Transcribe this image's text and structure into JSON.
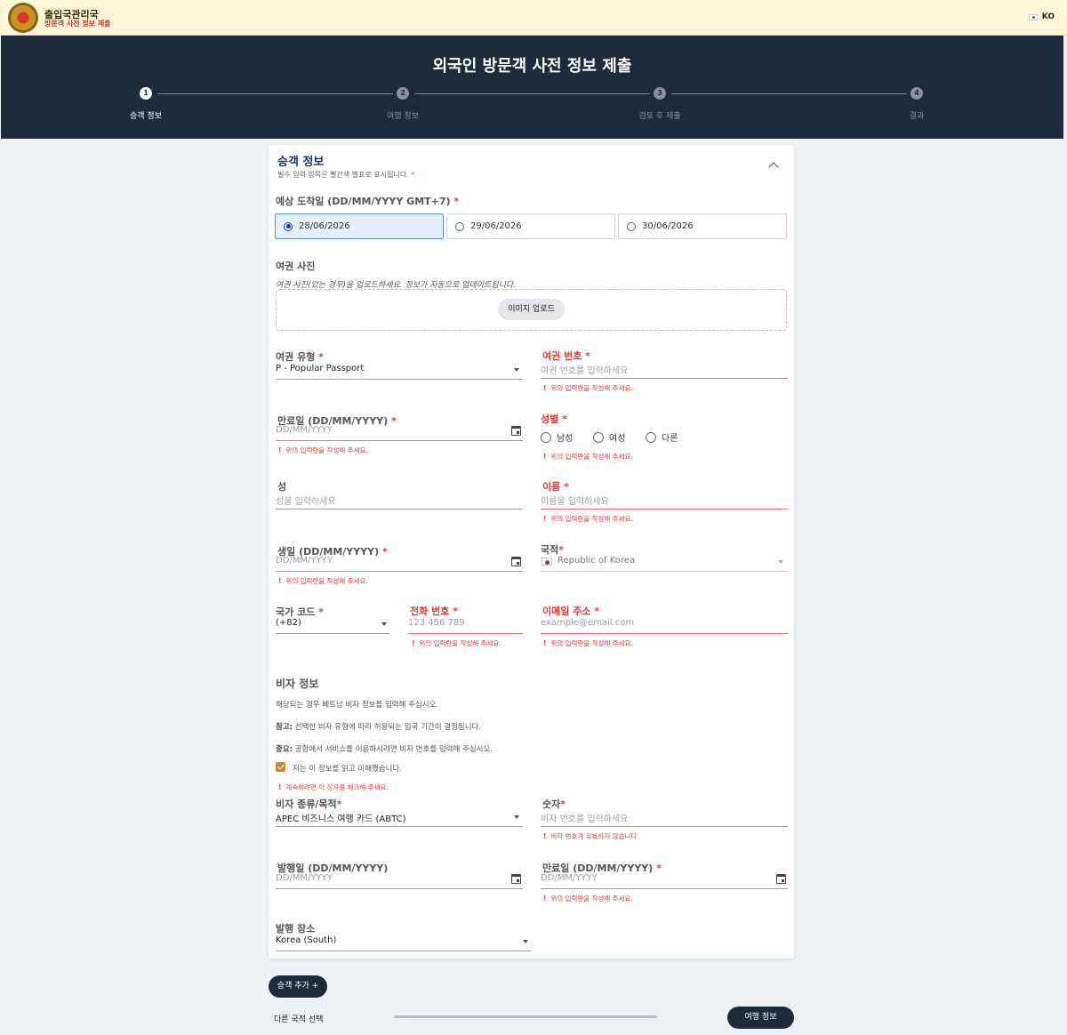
{
  "topbar": {
    "org_name": "출입국관리국",
    "org_sub": "방문객 사전 정보 제출",
    "lang": "KO"
  },
  "header": {
    "title": "외국인 방문객 사전 정보 제출",
    "steps": [
      {
        "num": "1",
        "label": "승객 정보"
      },
      {
        "num": "2",
        "label": "여행 정보"
      },
      {
        "num": "3",
        "label": "검토 후 제출"
      },
      {
        "num": "4",
        "label": "결과"
      }
    ]
  },
  "passenger": {
    "title": "승객 정보",
    "note": "필수 입력 항목은 빨간색 별표로 표시됩니다.",
    "req_mark": "*",
    "arrival_label": "예상 도착일 (DD/MM/YYYY GMT+7)",
    "arrival_options": [
      "28/06/2026",
      "29/06/2026",
      "30/06/2026"
    ],
    "passport_photo_label": "여권 사진",
    "passport_photo_hint": "여권 사진(있는 경우)을 업로드하세요. 정보가 자동으로 업데이트됩니다.",
    "upload_button": "이미지 업로드",
    "passport_type_label": "여권 유형",
    "passport_type_value": "P - Popular Passport",
    "passport_no_label": "여권 번호",
    "passport_no_placeholder": "여권 번호를 입력하세요",
    "error_required": "위의 입력란을 작성해 주세요.",
    "error_icon": "!",
    "expiry_label": "만료일 (DD/MM/YYYY)",
    "date_placeholder": "DD/MM/YYYY",
    "gender_label": "성별",
    "gender_options": [
      "남성",
      "여성",
      "다른"
    ],
    "surname_label": "성",
    "surname_placeholder": "성을 입력하세요",
    "given_label": "이름",
    "given_placeholder": "이름을 입력하세요",
    "dob_label": "생일 (DD/MM/YYYY)",
    "nationality_label": "국적",
    "nationality_value": "Republic of Korea",
    "country_code_label": "국가 코드",
    "country_code_value": "(+82)",
    "phone_label": "전화 번호",
    "phone_placeholder": "123 456 789",
    "email_label": "이메일 주소",
    "email_placeholder": "example@email.com"
  },
  "visa": {
    "title": "비자 정보",
    "text1": "해당되는 경우 베트남 비자 정보를 입력해 주십시오.",
    "text2_bold": "참고:",
    "text2": " 선택한 비자 유형에 따라 허용되는 입국 기간이 결정됩니다.",
    "text3_bold": "중요:",
    "text3": " 공항에서 서비스를 이용하시려면 비자 번호를 입력해 주십시오.",
    "checkbox_label": "저는 이 정보를 읽고 이해했습니다.",
    "checkbox_error": "계속하려면 이 상자를 체크해 주세요.",
    "type_label": "비자 종류/목적",
    "type_value": "APEC 비즈니스 여행 카드 (ABTC)",
    "number_label": "숫자",
    "number_placeholder": "비자 번호를 입력하세요",
    "number_error": "비자 번호가 유효하지 않습니다",
    "issue_date_label": "발행일 (DD/MM/YYYY)",
    "expiry_label": "만료일 (DD/MM/YYYY)",
    "issue_place_label": "발행 장소",
    "issue_place_value": "Korea (South)"
  },
  "footer": {
    "add_passenger": "승객 추가 +",
    "other_nationality": "다른 국적 선택",
    "next_button": "여행 정보"
  }
}
